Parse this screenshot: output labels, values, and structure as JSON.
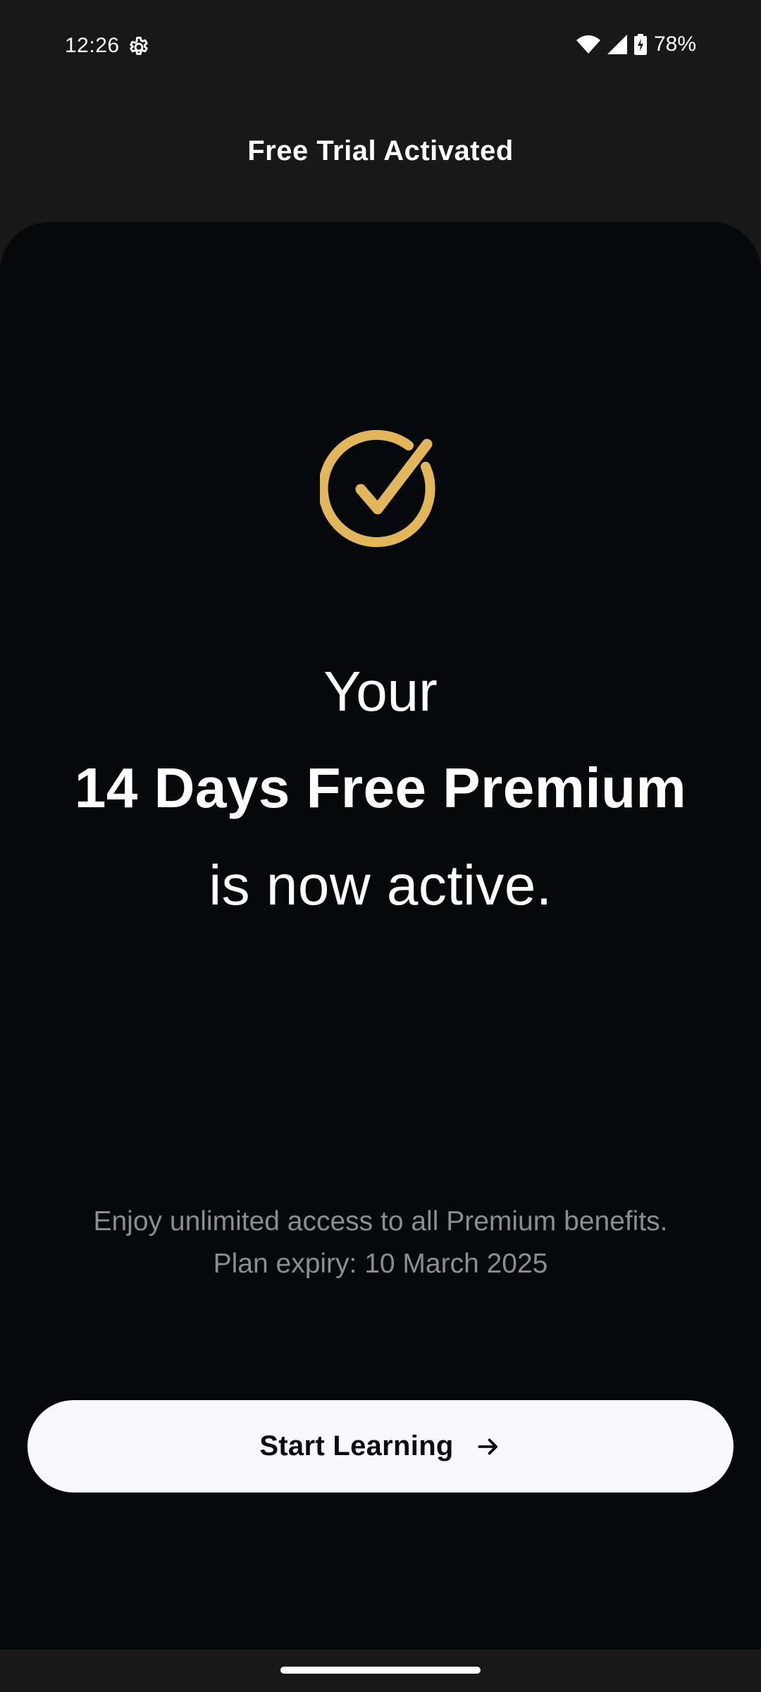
{
  "status_bar": {
    "time": "12:26",
    "battery_percent": "78%",
    "icons": [
      "gear-icon",
      "wifi-icon",
      "signal-icon",
      "battery-charging-icon"
    ]
  },
  "header": {
    "title": "Free Trial Activated"
  },
  "main": {
    "icon": "check-circle-icon",
    "accent_color": "#E2B659",
    "headline_line1": "Your",
    "headline_line2": "14 Days Free Premium",
    "headline_line3": "is now active.",
    "benefits": "Enjoy unlimited access to all Premium benefits.",
    "expiry": "Plan expiry: 10 March 2025"
  },
  "cta": {
    "label": "Start Learning",
    "icon": "arrow-right-icon"
  },
  "colors": {
    "background": "#181818",
    "panel": "#05090C",
    "button": "#F8F9FD",
    "muted_text": "#8A8D92"
  }
}
